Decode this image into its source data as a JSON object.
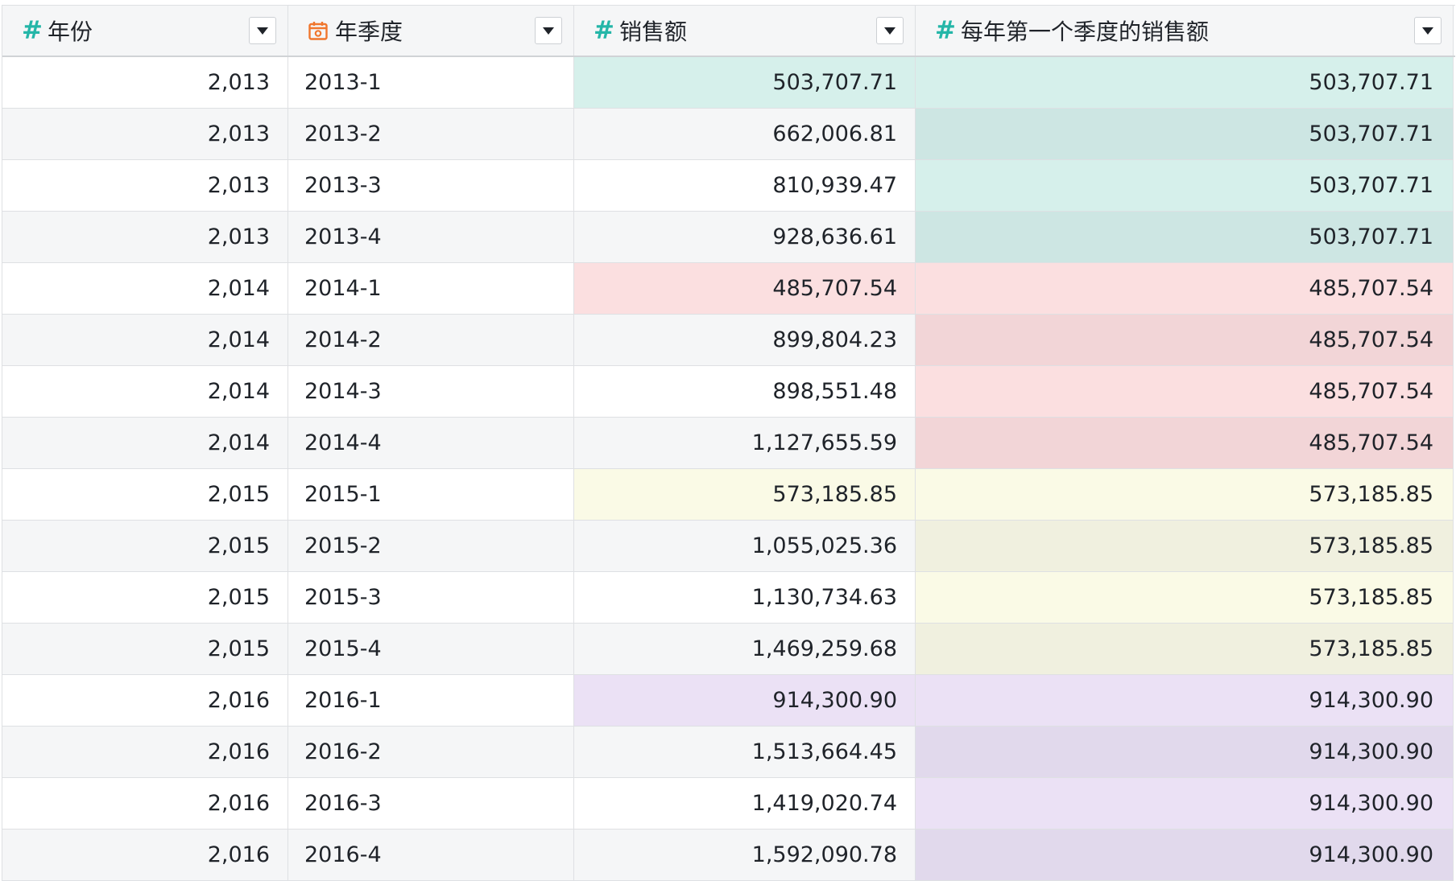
{
  "columns": [
    {
      "label": "年份",
      "icon": "number-icon"
    },
    {
      "label": "年季度",
      "icon": "calendar-icon"
    },
    {
      "label": "销售额",
      "icon": "number-icon"
    },
    {
      "label": "每年第一个季度的销售额",
      "icon": "number-icon"
    }
  ],
  "colors": {
    "2013": {
      "light": "#d6f0eb",
      "dark": "#cde6e3"
    },
    "2014": {
      "light": "#fbdfe0",
      "dark": "#f2d5d7"
    },
    "2015": {
      "light": "#fafae6",
      "dark": "#f0f0df"
    },
    "2016": {
      "light": "#ebe1f5",
      "dark": "#e1d9ec"
    }
  },
  "rows": [
    {
      "year": "2,013",
      "quarter": "2013-1",
      "sales": "503,707.71",
      "first": "503,707.71",
      "group": "2013",
      "is_first": true
    },
    {
      "year": "2,013",
      "quarter": "2013-2",
      "sales": "662,006.81",
      "first": "503,707.71",
      "group": "2013",
      "is_first": false
    },
    {
      "year": "2,013",
      "quarter": "2013-3",
      "sales": "810,939.47",
      "first": "503,707.71",
      "group": "2013",
      "is_first": false
    },
    {
      "year": "2,013",
      "quarter": "2013-4",
      "sales": "928,636.61",
      "first": "503,707.71",
      "group": "2013",
      "is_first": false
    },
    {
      "year": "2,014",
      "quarter": "2014-1",
      "sales": "485,707.54",
      "first": "485,707.54",
      "group": "2014",
      "is_first": true
    },
    {
      "year": "2,014",
      "quarter": "2014-2",
      "sales": "899,804.23",
      "first": "485,707.54",
      "group": "2014",
      "is_first": false
    },
    {
      "year": "2,014",
      "quarter": "2014-3",
      "sales": "898,551.48",
      "first": "485,707.54",
      "group": "2014",
      "is_first": false
    },
    {
      "year": "2,014",
      "quarter": "2014-4",
      "sales": "1,127,655.59",
      "first": "485,707.54",
      "group": "2014",
      "is_first": false
    },
    {
      "year": "2,015",
      "quarter": "2015-1",
      "sales": "573,185.85",
      "first": "573,185.85",
      "group": "2015",
      "is_first": true
    },
    {
      "year": "2,015",
      "quarter": "2015-2",
      "sales": "1,055,025.36",
      "first": "573,185.85",
      "group": "2015",
      "is_first": false
    },
    {
      "year": "2,015",
      "quarter": "2015-3",
      "sales": "1,130,734.63",
      "first": "573,185.85",
      "group": "2015",
      "is_first": false
    },
    {
      "year": "2,015",
      "quarter": "2015-4",
      "sales": "1,469,259.68",
      "first": "573,185.85",
      "group": "2015",
      "is_first": false
    },
    {
      "year": "2,016",
      "quarter": "2016-1",
      "sales": "914,300.90",
      "first": "914,300.90",
      "group": "2016",
      "is_first": true
    },
    {
      "year": "2,016",
      "quarter": "2016-2",
      "sales": "1,513,664.45",
      "first": "914,300.90",
      "group": "2016",
      "is_first": false
    },
    {
      "year": "2,016",
      "quarter": "2016-3",
      "sales": "1,419,020.74",
      "first": "914,300.90",
      "group": "2016",
      "is_first": false
    },
    {
      "year": "2,016",
      "quarter": "2016-4",
      "sales": "1,592,090.78",
      "first": "914,300.90",
      "group": "2016",
      "is_first": false
    }
  ]
}
